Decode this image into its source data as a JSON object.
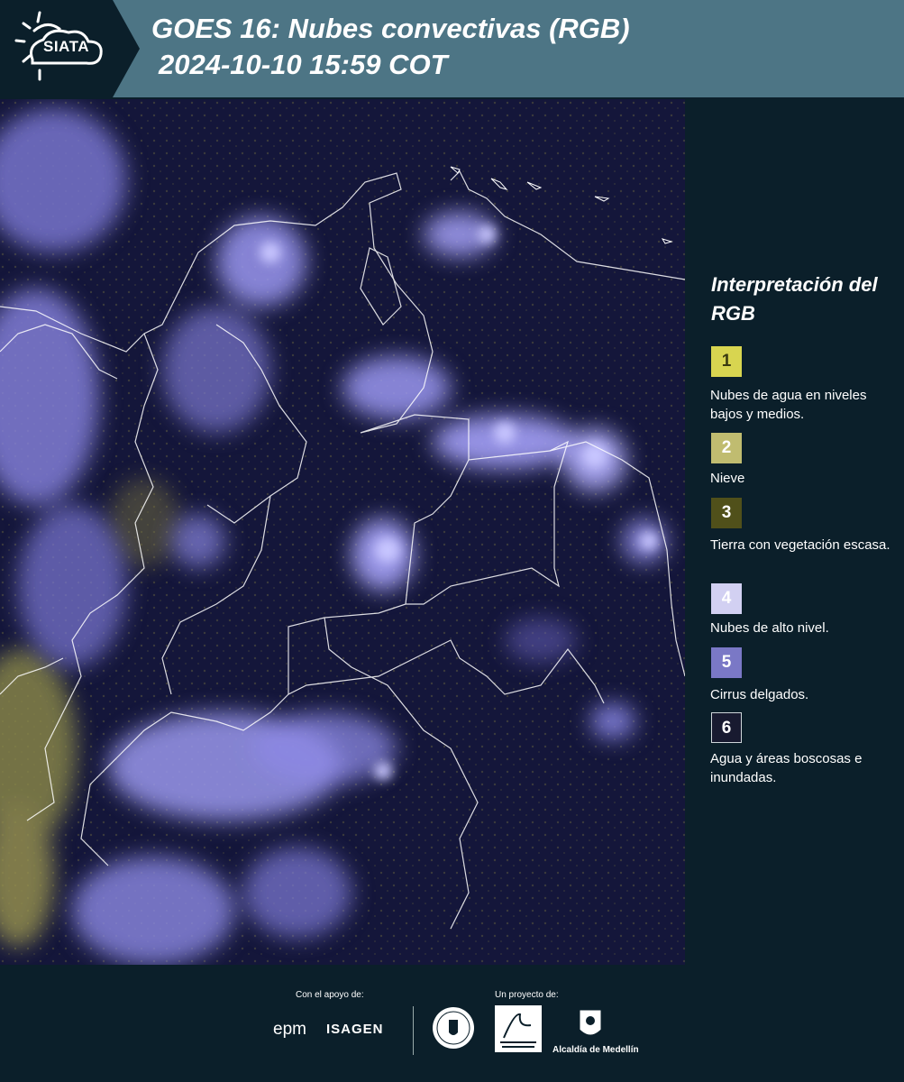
{
  "header": {
    "logo_text": "SIATA",
    "title_line1": "GOES 16: Nubes convectivas (RGB)",
    "title_line2": "2024-10-10 15:59 COT"
  },
  "legend": {
    "title": "Interpretación del RGB",
    "items": [
      {
        "number": "1",
        "label": "Nubes de agua en niveles bajos y medios.",
        "color": "#d8d550",
        "text_color": "#3a3a10"
      },
      {
        "number": "2",
        "label": "Nieve",
        "color": "#c0bc70",
        "text_color": "#ffffff"
      },
      {
        "number": "3",
        "label": "Tierra con vegetación escasa.",
        "color": "#50501a",
        "text_color": "#ffffff"
      },
      {
        "number": "4",
        "label": "Nubes de alto nivel.",
        "color": "#d2d0f2",
        "text_color": "#ffffff"
      },
      {
        "number": "5",
        "label": "Cirrus delgados.",
        "color": "#7a78c6",
        "text_color": "#ffffff"
      },
      {
        "number": "6",
        "label": "Agua y áreas boscosas e inundadas.",
        "color": "#181a30",
        "text_color": "#ffffff"
      }
    ]
  },
  "footer": {
    "support_caption": "Con el apoyo de:",
    "project_caption": "Un proyecto de:",
    "sponsor_epm": "epm",
    "sponsor_isagen": "ISAGEN",
    "alcaldia": "Alcaldía de Medellín"
  },
  "colors": {
    "header_bg": "#4d7585",
    "panel_bg": "#0b1f2a",
    "map_bg": "#14163a",
    "cloud": "#8f8cf0"
  }
}
